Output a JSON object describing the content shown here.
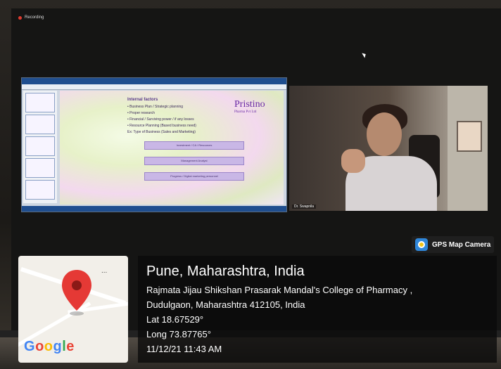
{
  "recording": {
    "label": "Recording"
  },
  "presentation": {
    "slide_title": "Internal factors",
    "bullets": [
      "• Business Plan / Strategic planning",
      "• Proper research",
      "• Financial / Surviving power / if any losses",
      "• Resource Planning (Based business need)",
      "Ex: Type of Business (Sales and Marketing)"
    ],
    "boxes": [
      "Investment / CA / Resources",
      "Management Analyst",
      "Progress / Digital marketing personnel"
    ],
    "logo": "Pristino",
    "logo_sub": "Pharma Pvt Ltd"
  },
  "video": {
    "participant_name": "Dr. Swapnila"
  },
  "gps": {
    "badge_label": "GPS Map Camera",
    "map_more": "...",
    "google": [
      "G",
      "o",
      "o",
      "g",
      "l",
      "e"
    ],
    "google_colors": [
      "#4285F4",
      "#EA4335",
      "#FBBC05",
      "#4285F4",
      "#34A853",
      "#EA4335"
    ],
    "city": "Pune, Maharashtra, India",
    "address_line1": "Rajmata Jijau Shikshan Prasarak Mandal's College of Pharmacy ,",
    "address_line2": "Dudulgaon, Maharashtra 412105, India",
    "lat": "Lat 18.67529°",
    "long": "Long 73.87765°",
    "datetime": "11/12/21 11:43 AM"
  }
}
